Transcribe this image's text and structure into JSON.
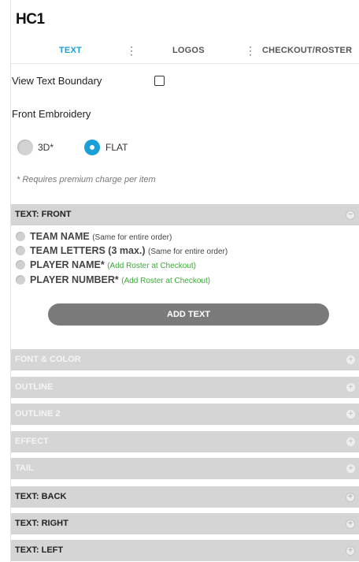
{
  "title": "HC1",
  "tabs": [
    {
      "label": "TEXT",
      "active": true
    },
    {
      "label": "LOGOS",
      "active": false
    },
    {
      "label": "CHECKOUT/ROSTER",
      "active": false
    }
  ],
  "tab_separator": "⋮",
  "view_text_boundary": {
    "label": "View Text Boundary",
    "checked": false
  },
  "front_embroidery": {
    "label": "Front Embroidery",
    "options": [
      {
        "label": "3D*",
        "selected": false
      },
      {
        "label": "FLAT",
        "selected": true
      }
    ],
    "note": "* Requires premium charge per item"
  },
  "text_front": {
    "label": "TEXT: FRONT",
    "toggle": "−",
    "options": [
      {
        "name": "TEAM NAME",
        "hint": "(Same for entire order)",
        "hint_color": "gray"
      },
      {
        "name": "TEAM LETTERS (3 max.)",
        "hint": "(Same for entire order)",
        "hint_color": "gray"
      },
      {
        "name": "PLAYER NAME*",
        "hint": "(Add Roster at Checkout)",
        "hint_color": "green"
      },
      {
        "name": "PLAYER NUMBER*",
        "hint": "(Add Roster at Checkout)",
        "hint_color": "green"
      }
    ],
    "add_button": "ADD TEXT"
  },
  "sections": [
    {
      "label": "FONT & COLOR",
      "toggle": "+",
      "enabled": false
    },
    {
      "label": "OUTLINE",
      "toggle": "+",
      "enabled": false
    },
    {
      "label": "OUTLINE 2",
      "toggle": "+",
      "enabled": false
    },
    {
      "label": "EFFECT",
      "toggle": "+",
      "enabled": false
    },
    {
      "label": "TAIL",
      "toggle": "+",
      "enabled": false
    },
    {
      "label": "TEXT: BACK",
      "toggle": "+",
      "enabled": true
    },
    {
      "label": "TEXT: RIGHT",
      "toggle": "+",
      "enabled": true
    },
    {
      "label": "TEXT: LEFT",
      "toggle": "+",
      "enabled": true
    }
  ],
  "colors": {
    "accent": "#1a9fd6",
    "green": "#3aaa35",
    "bar": "#d5d5d5",
    "button": "#7a7a7a"
  }
}
